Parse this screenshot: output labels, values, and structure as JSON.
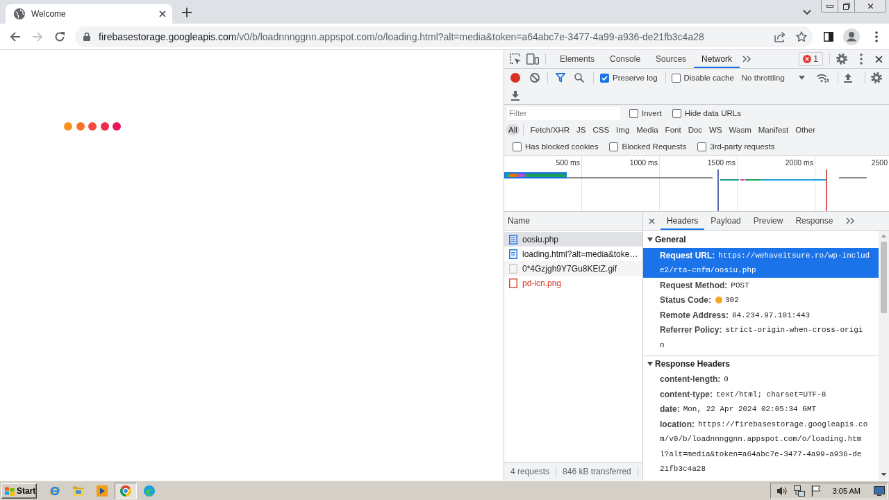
{
  "browser": {
    "tabs": [
      {
        "title": "Welcome",
        "selected": true
      }
    ],
    "nav": [
      {
        "kind": "back",
        "disabled": false
      },
      {
        "kind": "forward",
        "disabled": true
      },
      {
        "kind": "reload",
        "disabled": false
      }
    ],
    "address": {
      "host": "firebasestorage.googleapis.com",
      "path": "/v0/b/loadnnnggnn.appspot.com/o/loading.html?alt=media&token=a64abc7e-3477-4a99-a936-de21fb3c4a28"
    }
  },
  "page": {
    "loader_dots": [
      {
        "color": "#f7931e"
      },
      {
        "color": "#f6712b"
      },
      {
        "color": "#f24c3c"
      },
      {
        "color": "#ec2c4e"
      },
      {
        "color": "#e6135f"
      }
    ]
  },
  "devtools": {
    "panel_tabs": [
      {
        "label": "Elements",
        "selected": false
      },
      {
        "label": "Console",
        "selected": false
      },
      {
        "label": "Sources",
        "selected": false
      },
      {
        "label": "Network",
        "selected": true
      }
    ],
    "error_count": "1",
    "recording": true,
    "filter_toggled": true,
    "options": [
      {
        "label": "Preserve log",
        "checked": true
      },
      {
        "label": "Disable cache",
        "checked": false
      }
    ],
    "throttling": "No throttling",
    "filter": {
      "placeholder": "Filter"
    },
    "filter_options": [
      {
        "label": "Invert",
        "checked": false
      },
      {
        "label": "Hide data URLs",
        "checked": false
      }
    ],
    "type_filters": [
      {
        "label": "All",
        "selected": true
      },
      {
        "label": "Fetch/XHR",
        "selected": false
      },
      {
        "label": "JS",
        "selected": false
      },
      {
        "label": "CSS",
        "selected": false
      },
      {
        "label": "Img",
        "selected": false
      },
      {
        "label": "Media",
        "selected": false
      },
      {
        "label": "Font",
        "selected": false
      },
      {
        "label": "Doc",
        "selected": false
      },
      {
        "label": "WS",
        "selected": false
      },
      {
        "label": "Wasm",
        "selected": false
      },
      {
        "label": "Manifest",
        "selected": false
      },
      {
        "label": "Other",
        "selected": false
      }
    ],
    "blocked_options": [
      {
        "label": "Has blocked cookies",
        "checked": false
      },
      {
        "label": "Blocked Requests",
        "checked": false
      },
      {
        "label": "3rd-party requests",
        "checked": false
      }
    ],
    "overview": {
      "ticks": [
        "500 ms",
        "1000 ms",
        "1500 ms",
        "2000 ms",
        "2500"
      ]
    },
    "requests": {
      "column": "Name",
      "rows": [
        {
          "name": "oosiu.php",
          "kind": "document",
          "selected": true,
          "failed": false
        },
        {
          "name": "loading.html?alt=media&toke…",
          "kind": "document",
          "selected": false,
          "failed": false
        },
        {
          "name": "0*4Gzjgh9Y7Gu8KEtZ.gif",
          "kind": "image",
          "selected": false,
          "failed": false
        },
        {
          "name": "pd-icn.png",
          "kind": "image",
          "selected": false,
          "failed": true
        }
      ]
    },
    "summary": [
      "4 requests",
      "846 kB transferred"
    ],
    "detail": {
      "tabs": [
        {
          "label": "Headers",
          "selected": true
        },
        {
          "label": "Payload",
          "selected": false
        },
        {
          "label": "Preview",
          "selected": false
        },
        {
          "label": "Response",
          "selected": false
        }
      ],
      "sections": [
        {
          "title": "General",
          "expanded": true,
          "rows": [
            {
              "key": "Request URL:",
              "value_lines": [
                "https://wehaveitsure.ro/wp-includ",
                "e2/rta-cnfm/oosiu.php"
              ],
              "selected": true
            },
            {
              "key": "Request Method:",
              "value_lines": [
                "POST"
              ],
              "selected": false
            },
            {
              "key": "Status Code:",
              "value_lines": [
                "302"
              ],
              "color": "#f5a623",
              "selected": false
            },
            {
              "key": "Remote Address:",
              "value_lines": [
                "84.234.97.101:443"
              ],
              "selected": false
            },
            {
              "key": "Referrer Policy:",
              "value_lines": [
                "strict-origin-when-cross-origi",
                "n"
              ],
              "selected": false
            }
          ]
        },
        {
          "title": "Response Headers",
          "expanded": true,
          "rows": [
            {
              "key": "content-length:",
              "value_lines": [
                "0"
              ],
              "selected": false
            },
            {
              "key": "content-type:",
              "value_lines": [
                "text/html; charset=UTF-8"
              ],
              "selected": false
            },
            {
              "key": "date:",
              "value_lines": [
                "Mon, 22 Apr 2024 02:05:34 GMT"
              ],
              "selected": false
            },
            {
              "key": "location:",
              "value_lines": [
                "https://firebasestorage.googleapis.co",
                "m/v0/b/loadnnnggnn.appspot.com/o/loading.htm",
                "l?alt=media&token=a64abc7e-3477-4a99-a936-de",
                "21fb3c4a28"
              ],
              "selected": false
            }
          ]
        }
      ]
    }
  },
  "taskbar": {
    "start": "Start",
    "apps": [
      {
        "kind": "ie",
        "selected": false
      },
      {
        "kind": "explorer",
        "selected": false
      },
      {
        "kind": "media",
        "selected": false
      },
      {
        "kind": "chrome",
        "selected": true
      },
      {
        "kind": "edge",
        "selected": false
      }
    ],
    "tray": [
      {
        "kind": "volume"
      },
      {
        "kind": "network"
      },
      {
        "kind": "flag"
      }
    ],
    "clock": "3:05 AM"
  }
}
